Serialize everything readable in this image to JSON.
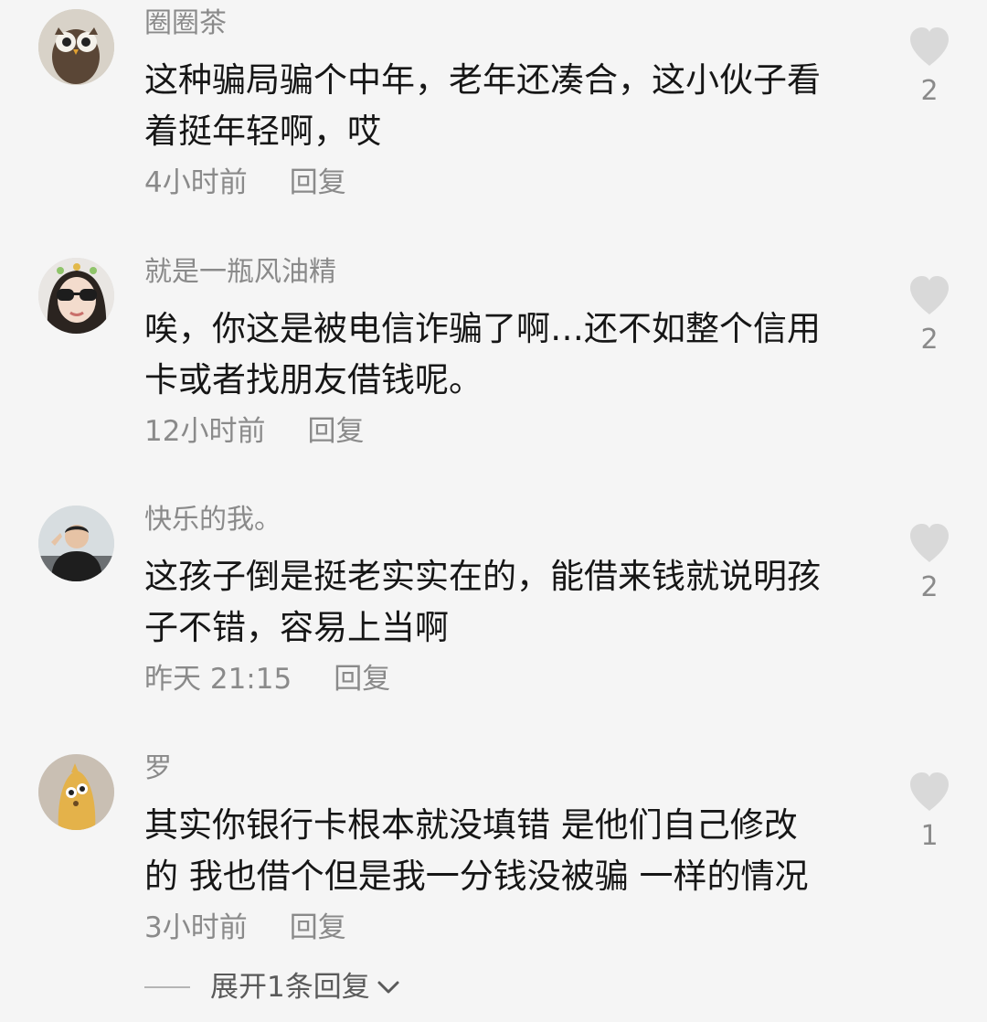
{
  "comments": [
    {
      "username": "圈圈茶",
      "text": "这种骗局骗个中年，老年还凑合，这小伙子看\n着挺年轻啊，哎",
      "time": "4小时前",
      "reply": "回复",
      "likes": "2",
      "avatar_icon": "owl-avatar-icon"
    },
    {
      "username": "就是一瓶风油精",
      "text": "唉，你这是被电信诈骗了啊…还不如整个信用\n卡或者找朋友借钱呢。",
      "time": "12小时前",
      "reply": "回复",
      "likes": "2",
      "avatar_icon": "woman-sunglasses-avatar-icon"
    },
    {
      "username": "快乐的我。",
      "text": "这孩子倒是挺老实实在的，能借来钱就说明孩\n子不错，容易上当啊",
      "time": "昨天 21:15",
      "reply": "回复",
      "likes": "2",
      "avatar_icon": "man-photo-avatar-icon"
    },
    {
      "username": "罗",
      "text": "其实你银行卡根本就没填错 是他们自己修改\n的 我也借个但是我一分钱没被骗 一样的情况",
      "time": "3小时前",
      "reply": "回复",
      "likes": "1",
      "avatar_icon": "cartoon-chick-avatar-icon"
    }
  ],
  "expand_replies": "展开1条回复",
  "colors": {
    "background": "#f5f5f5",
    "text": "#161616",
    "muted": "#8a8a8a",
    "heart": "#d9d9d9"
  }
}
